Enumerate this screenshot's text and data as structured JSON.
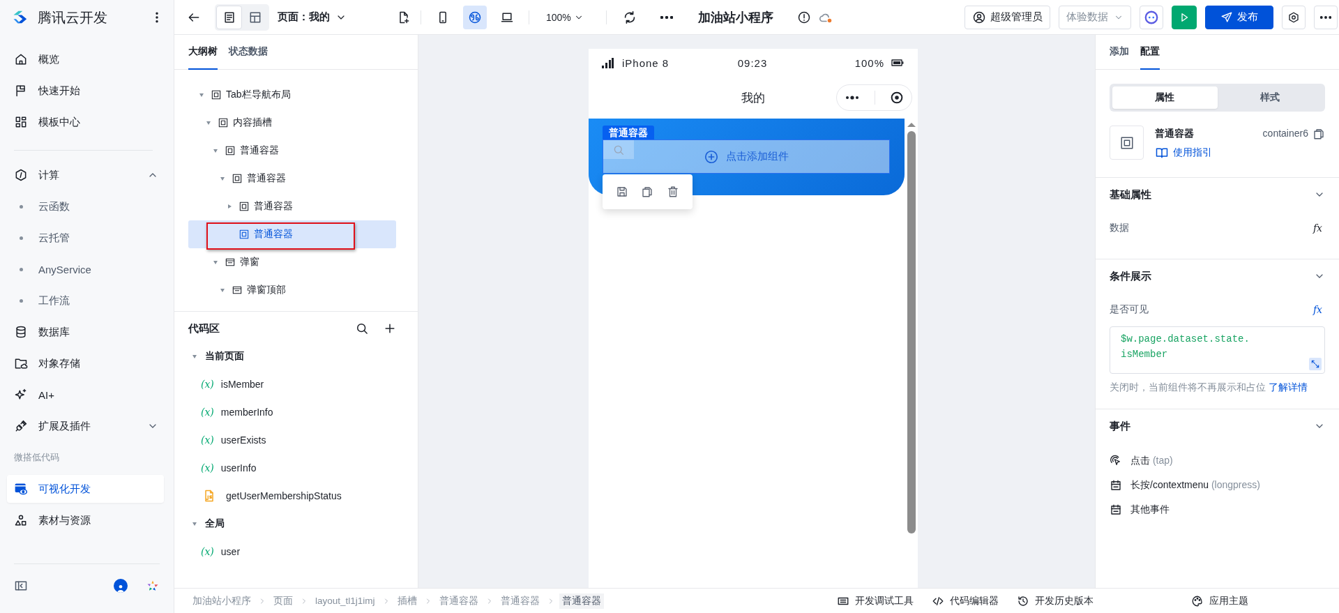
{
  "sidebar": {
    "product": "腾讯云开发",
    "groups": [
      {
        "items": [
          {
            "kind": "nav",
            "label": "概览",
            "selected": false
          },
          {
            "kind": "nav",
            "label": "快速开始",
            "selected": false
          },
          {
            "kind": "nav",
            "label": "模板中心",
            "selected": false
          }
        ]
      },
      {
        "items": [
          {
            "kind": "nav",
            "label": "计算",
            "selected": false,
            "expanded": true,
            "children": [
              {
                "kind": "sub",
                "label": "云函数",
                "selected": false
              },
              {
                "kind": "sub",
                "label": "云托管",
                "selected": false
              },
              {
                "kind": "sub",
                "label": "AnyService",
                "selected": false
              },
              {
                "kind": "sub",
                "label": "工作流",
                "selected": false
              }
            ]
          },
          {
            "kind": "nav",
            "label": "数据库",
            "selected": false
          },
          {
            "kind": "nav",
            "label": "对象存储",
            "selected": false
          },
          {
            "kind": "nav",
            "label": "AI+",
            "selected": false
          },
          {
            "kind": "nav",
            "label": "扩展及插件",
            "selected": false,
            "expanded": false
          },
          {
            "kind": "heading",
            "label": "微搭低代码"
          },
          {
            "kind": "nav",
            "label": "可视化开发",
            "selected": true
          },
          {
            "kind": "nav",
            "label": "素材与资源",
            "selected": false
          }
        ]
      }
    ]
  },
  "toolbar": {
    "view_modes": [
      {
        "selected": true
      },
      {
        "selected": false
      }
    ],
    "page_picker": "页面：我的",
    "devices": [
      {
        "selected": false
      },
      {
        "selected": true
      },
      {
        "selected": false
      }
    ],
    "zoom": "100%",
    "app_title": "加油站小程序",
    "role": "超级管理员",
    "dataset": "体验数据",
    "publish": "发布"
  },
  "outline": {
    "tabs": [
      {
        "label": "大纲树",
        "selected": true
      },
      {
        "label": "状态数据",
        "selected": false
      }
    ],
    "tree": [
      {
        "kind": "container",
        "label": "Tab栏导航布局",
        "expanded": true,
        "selected": false,
        "highlighted": false,
        "children": [
          {
            "kind": "container",
            "label": "内容插槽",
            "expanded": true,
            "selected": false,
            "highlighted": false,
            "children": [
              {
                "kind": "container",
                "label": "普通容器",
                "expanded": true,
                "selected": false,
                "highlighted": false,
                "children": [
                  {
                    "kind": "container",
                    "label": "普通容器",
                    "expanded": true,
                    "selected": false,
                    "highlighted": false,
                    "children": [
                      {
                        "kind": "container",
                        "label": "普通容器",
                        "expanded": false,
                        "selected": false,
                        "highlighted": false
                      },
                      {
                        "kind": "container",
                        "label": "普通容器",
                        "selected": true,
                        "highlighted": true
                      }
                    ]
                  }
                ]
              },
              {
                "kind": "popup",
                "label": "弹窗",
                "expanded": true,
                "selected": false,
                "highlighted": false,
                "children": [
                  {
                    "kind": "popup",
                    "label": "弹窗顶部",
                    "expanded": true,
                    "selected": false,
                    "highlighted": false
                  }
                ]
              }
            ]
          }
        ]
      }
    ]
  },
  "code": {
    "title": "代码区",
    "groups": [
      {
        "label": "当前页面",
        "expanded": true,
        "items": [
          {
            "kind": "variable",
            "badge": "(x)",
            "name": "isMember"
          },
          {
            "kind": "variable",
            "badge": "(x)",
            "name": "memberInfo"
          },
          {
            "kind": "variable",
            "badge": "(x)",
            "name": "userExists"
          },
          {
            "kind": "variable",
            "badge": "(x)",
            "name": "userInfo"
          },
          {
            "kind": "script",
            "name": "getUserMembershipStatus"
          }
        ]
      },
      {
        "label": "全局",
        "expanded": true,
        "items": [
          {
            "kind": "variable",
            "badge": "(x)",
            "name": "user"
          }
        ]
      }
    ]
  },
  "preview": {
    "status": {
      "device": "iPhone 8",
      "time": "09:23",
      "battery": "100%"
    },
    "nav_title": "我的",
    "selection_tag": "普通容器",
    "add_hint": "点击添加组件"
  },
  "inspector": {
    "tabs": [
      {
        "label": "添加",
        "selected": false
      },
      {
        "label": "配置",
        "selected": true
      }
    ],
    "modes": [
      {
        "label": "属性",
        "selected": true
      },
      {
        "label": "样式",
        "selected": false
      }
    ],
    "component": {
      "name": "普通容器",
      "id": "container6",
      "guide": "使用指引"
    },
    "sections": [
      {
        "kind": "fields",
        "title": "基础属性",
        "expanded": true,
        "fields": [
          {
            "label": "数据",
            "binding": "fx",
            "bound": false
          }
        ]
      },
      {
        "kind": "condition",
        "title": "条件展示",
        "expanded": true,
        "fields": [
          {
            "label": "是否可见",
            "binding": "fx",
            "bound": true
          }
        ],
        "expression": "$w.page.dataset.state.isMember",
        "hint": "关闭时，当前组件将不再展示和占位",
        "hint_link": "了解详情"
      },
      {
        "kind": "events",
        "title": "事件",
        "expanded": true,
        "events": [
          {
            "kind": "tap",
            "label": "点击",
            "detail": "(tap)"
          },
          {
            "kind": "other",
            "label": "长按/contextmenu",
            "detail": "(longpress)"
          },
          {
            "kind": "other",
            "label": "其他事件"
          }
        ]
      }
    ]
  },
  "footer": {
    "breadcrumbs": [
      {
        "label": "加油站小程序",
        "selected": false
      },
      {
        "label": "页面",
        "selected": false
      },
      {
        "label": "layout_tl1j1imj",
        "selected": false
      },
      {
        "label": "插槽",
        "selected": false
      },
      {
        "label": "普通容器",
        "selected": false
      },
      {
        "label": "普通容器",
        "selected": false
      },
      {
        "label": "普通容器",
        "selected": true
      }
    ],
    "tools": [
      "开发调试工具",
      "代码编辑器",
      "开发历史版本",
      "应用主题"
    ]
  }
}
